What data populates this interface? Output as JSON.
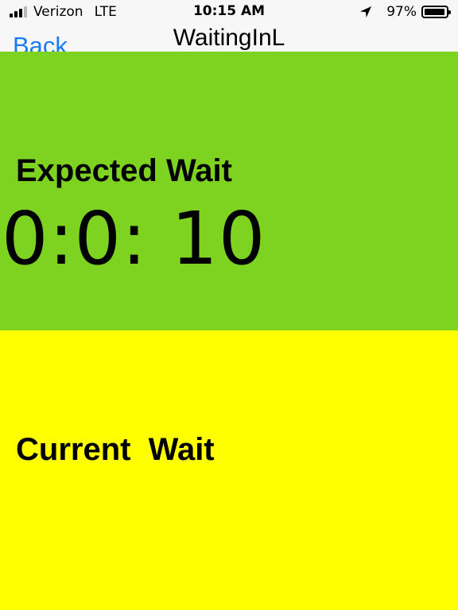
{
  "status_bar": {
    "carrier": "Verizon",
    "network": "LTE",
    "time": "10:15 AM",
    "battery_percent": "97%",
    "icons": [
      "signal-icon",
      "location-icon",
      "battery-icon"
    ]
  },
  "nav": {
    "back_label": "Back",
    "title": "WaitingInL"
  },
  "expected": {
    "label": "Expected Wait",
    "value": "0:0: 10",
    "color": "#7ed321"
  },
  "current": {
    "label": "Current  Wait",
    "color": "#ffff00"
  },
  "colors": {
    "accent": "#1a7cf5"
  }
}
